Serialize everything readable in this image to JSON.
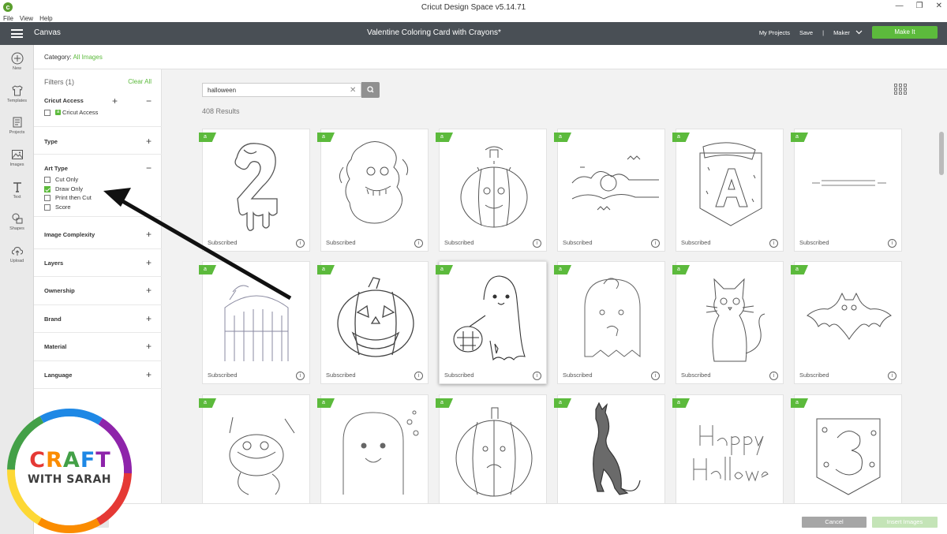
{
  "window": {
    "title": "Cricut Design Space  v5.14.71",
    "app_icon": "cricut-c-icon",
    "controls": [
      "—",
      "❐",
      "✕"
    ]
  },
  "menu": [
    "File",
    "View",
    "Help"
  ],
  "header": {
    "canvas_label": "Canvas",
    "project_title": "Valentine Coloring Card with Crayons*",
    "my_projects": "My Projects",
    "save": "Save",
    "separator": "|",
    "machine": "Maker",
    "make_it": "Make It"
  },
  "toolbar": [
    {
      "label": "New",
      "icon": "plus-circle-icon"
    },
    {
      "label": "Templates",
      "icon": "tshirt-icon"
    },
    {
      "label": "Projects",
      "icon": "projects-icon"
    },
    {
      "label": "Images",
      "icon": "image-icon"
    },
    {
      "label": "Text",
      "icon": "text-icon"
    },
    {
      "label": "Shapes",
      "icon": "shapes-icon"
    },
    {
      "label": "Upload",
      "icon": "upload-cloud-icon"
    }
  ],
  "category": {
    "prefix": "Category:",
    "value": "All Images"
  },
  "filters": {
    "heading": "Filters (1)",
    "clear": "Clear All",
    "cricut_access": {
      "title": "Cricut Access",
      "option": "Cricut Access"
    },
    "type": "Type",
    "art_type": {
      "title": "Art Type",
      "options": [
        {
          "label": "Cut Only",
          "checked": false
        },
        {
          "label": "Draw Only",
          "checked": true
        },
        {
          "label": "Print then Cut",
          "checked": false
        },
        {
          "label": "Score",
          "checked": false
        }
      ]
    },
    "collapsed": [
      "Image Complexity",
      "Layers",
      "Ownership",
      "Brand",
      "Material",
      "Language"
    ]
  },
  "search": {
    "value": "halloween",
    "clear_icon": "close-icon",
    "button_icon": "search-icon"
  },
  "results": {
    "count": "408 Results",
    "view_icon": "grid-view-icon"
  },
  "cards": [
    {
      "footer": "Subscribed",
      "art": "number-two-dripping"
    },
    {
      "footer": "Subscribed",
      "art": "zombie-monster"
    },
    {
      "footer": "Subscribed",
      "art": "jack-o-lantern-face"
    },
    {
      "footer": "Subscribed",
      "art": "moon-bats-clouds"
    },
    {
      "footer": "Subscribed",
      "art": "letter-a-pennant"
    },
    {
      "footer": "Subscribed",
      "art": "happy-halloween-text"
    },
    {
      "footer": "Subscribed",
      "art": "cemetery-gate"
    },
    {
      "footer": "Subscribed",
      "art": "carved-pumpkin"
    },
    {
      "footer": "Subscribed",
      "art": "ghost-with-basket"
    },
    {
      "footer": "Subscribed",
      "art": "zombie-ghost"
    },
    {
      "footer": "Subscribed",
      "art": "black-cat-sitting"
    },
    {
      "footer": "Subscribed",
      "art": "bat"
    },
    {
      "footer": "",
      "art": "monster-with-fork"
    },
    {
      "footer": "",
      "art": "cute-ghost"
    },
    {
      "footer": "",
      "art": "round-pumpkin"
    },
    {
      "footer": "",
      "art": "black-cat-arched"
    },
    {
      "footer": "",
      "art": "happy-halloween-script"
    },
    {
      "footer": "",
      "art": "number-three-pennant"
    }
  ],
  "card_badge": "a",
  "info_symbol": "i",
  "bottom": {
    "cancel": "Cancel",
    "insert": "Insert Images"
  },
  "watermark": {
    "line1": "CRAFT",
    "line2": "WITH SARAH"
  },
  "colors": {
    "header": "#494f55",
    "accent": "#5cba3c"
  }
}
